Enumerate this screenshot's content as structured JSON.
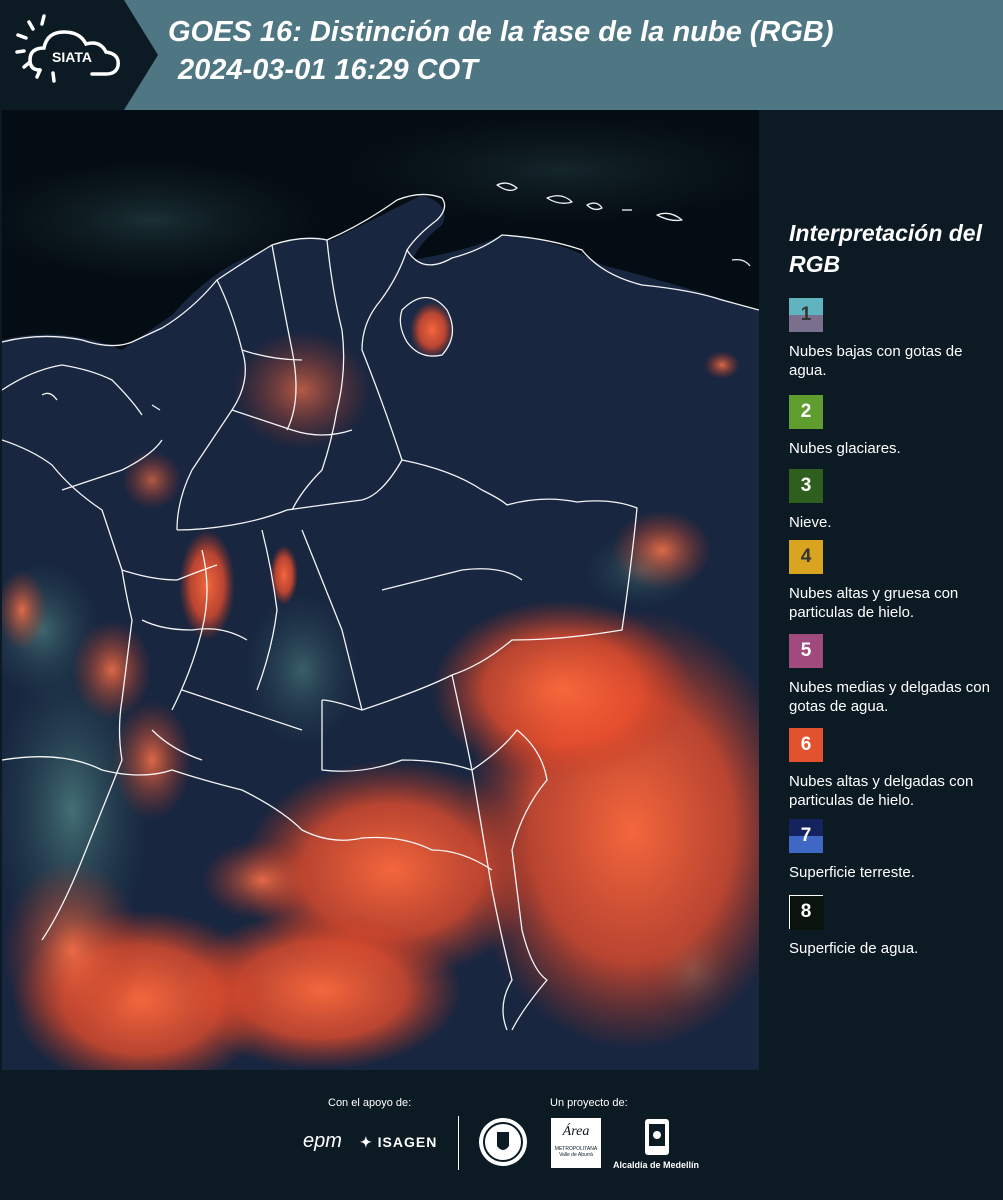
{
  "header": {
    "logo_text": "SIATA",
    "title": "GOES 16: Distinción de la fase de la nube (RGB)",
    "subtitle": "2024-03-01 16:29 COT"
  },
  "legend": {
    "title": "Interpretación del RGB",
    "items": [
      {
        "num": "1",
        "label": "Nubes bajas con gotas de agua.",
        "top_color": "#5fb4c0",
        "bottom_color": "#7a6f8c",
        "num_color": "#333333"
      },
      {
        "num": "2",
        "label": "Nubes glaciares.",
        "top_color": "#5f9e2e",
        "bottom_color": "#5f9e2e",
        "num_color": "#ffffff"
      },
      {
        "num": "3",
        "label": "Nieve.",
        "top_color": "#2f5f1f",
        "bottom_color": "#2f5f1f",
        "num_color": "#ffffff"
      },
      {
        "num": "4",
        "label": "Nubes altas y gruesa con particulas de hielo.",
        "top_color": "#d9a520",
        "bottom_color": "#d9a520",
        "num_color": "#333333"
      },
      {
        "num": "5",
        "label": "Nubes medias y delgadas con gotas de agua.",
        "top_color": "#a04a7e",
        "bottom_color": "#a04a7e",
        "num_color": "#ffffff"
      },
      {
        "num": "6",
        "label": "Nubes altas y delgadas con particulas de hielo.",
        "top_color": "#e2522e",
        "bottom_color": "#e2522e",
        "num_color": "#ffffff"
      },
      {
        "num": "7",
        "label": "Superficie terreste.",
        "top_color": "#14235e",
        "bottom_color": "#3f67c4",
        "num_color": "#ffffff"
      },
      {
        "num": "8",
        "label": "Superficie de agua.",
        "top_color": "#0a130c",
        "bottom_color": "#0a130c",
        "num_color": "#ffffff"
      }
    ]
  },
  "footer": {
    "support_label": "Con el apoyo de:",
    "project_label": "Un proyecto de:",
    "sponsor_1": "epm",
    "sponsor_2": "ISAGEN",
    "partner_1_line1": "Área",
    "partner_1_line2": "METROPOLITANA",
    "partner_1_line3": "Valle de Aburrá",
    "partner_2": "Alcaldía de Medellín"
  },
  "colors": {
    "header_bg": "#4e7683",
    "logo_bg": "#0c1a24",
    "panel_bg": "#0c1a24",
    "cloud_ice": "#f05a34",
    "land": "#1b2a45",
    "water": "#050d14",
    "borders": "#ffffff"
  }
}
